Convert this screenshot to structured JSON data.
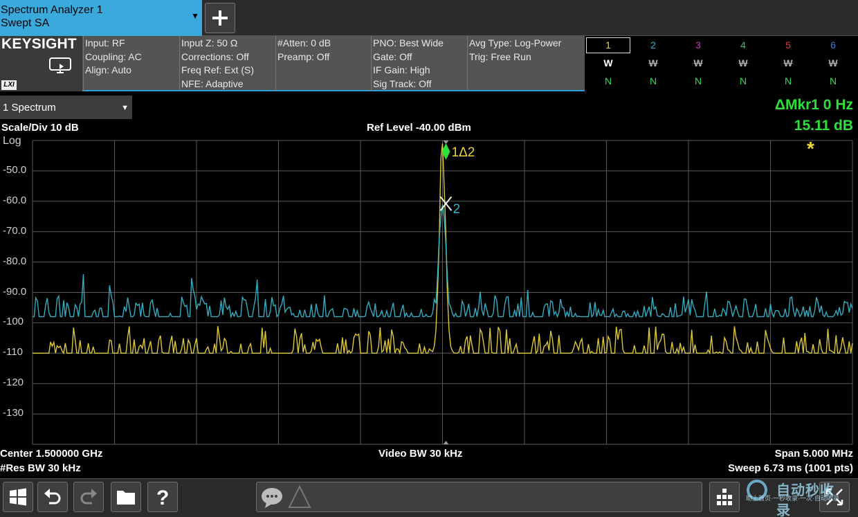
{
  "tabbar": {
    "app_name": "Spectrum Analyzer 1",
    "mode": "Swept SA",
    "dropdown_glyph": "▼",
    "add_label": "+"
  },
  "brand": {
    "logo": "KEYSIGHT",
    "lxi": "LXI"
  },
  "settings": {
    "col1": [
      "Input: RF",
      "Coupling: AC",
      "Align: Auto"
    ],
    "col2": [
      "Input Z: 50 Ω",
      "Corrections: Off",
      "Freq Ref: Ext (S)",
      "NFE: Adaptive"
    ],
    "col3": [
      "#Atten: 0 dB",
      "Preamp: Off"
    ],
    "col4": [
      "PNO: Best Wide",
      "Gate: Off",
      "IF Gain: High",
      "Sig Track: Off"
    ],
    "col5": [
      "Avg Type: Log-Power",
      "Trig: Free Run"
    ]
  },
  "traces": [
    {
      "num": "1",
      "type": "W",
      "det": "N",
      "color": "#e8d33a",
      "active": true
    },
    {
      "num": "2",
      "type": "W",
      "det": "N",
      "color": "#35b5c9",
      "active": false
    },
    {
      "num": "3",
      "type": "W",
      "det": "N",
      "color": "#c73ab7",
      "active": false
    },
    {
      "num": "4",
      "type": "W",
      "det": "N",
      "color": "#34c46a",
      "active": false
    },
    {
      "num": "5",
      "type": "W",
      "det": "N",
      "color": "#d63a3a",
      "active": false
    },
    {
      "num": "6",
      "type": "W",
      "det": "N",
      "color": "#3a7ae0",
      "active": false
    }
  ],
  "view": {
    "label": "1 Spectrum",
    "dropdown_glyph": "▼"
  },
  "plot": {
    "scale_div": "Scale/Div 10 dB",
    "ref_level": "Ref Level -40.00 dBm",
    "scale_type": "Log",
    "y_ticks": [
      "-50.0",
      "-60.0",
      "-70.0",
      "-80.0",
      "-90.0",
      "-100",
      "-110",
      "-120",
      "-130"
    ],
    "center": "Center 1.500000 GHz",
    "video_bw": "Video BW 30 kHz",
    "span": "Span 5.000 MHz",
    "res_bw": "#Res BW 30 kHz",
    "sweep": "Sweep 6.73 ms (1001 pts)",
    "marker_readout_1": "ΔMkr1  0 Hz",
    "marker_readout_2": "15.11 dB",
    "marker_delta_label": "1Δ2",
    "marker_ref_label": "2",
    "star": "*"
  },
  "chart_data": {
    "type": "line",
    "ylim": [
      -140,
      -40
    ],
    "xlabel": "",
    "ylabel": "",
    "series": [
      {
        "color": "#e8d33a",
        "noise_floor": -110,
        "peak": -47
      },
      {
        "color": "#35b5c9",
        "noise_floor": -98,
        "peak": -61
      }
    ],
    "grid": true
  },
  "watermark": {
    "title": "自动秒收录",
    "subtitle": "助上首页·一秒收录·一次·自动收录"
  }
}
